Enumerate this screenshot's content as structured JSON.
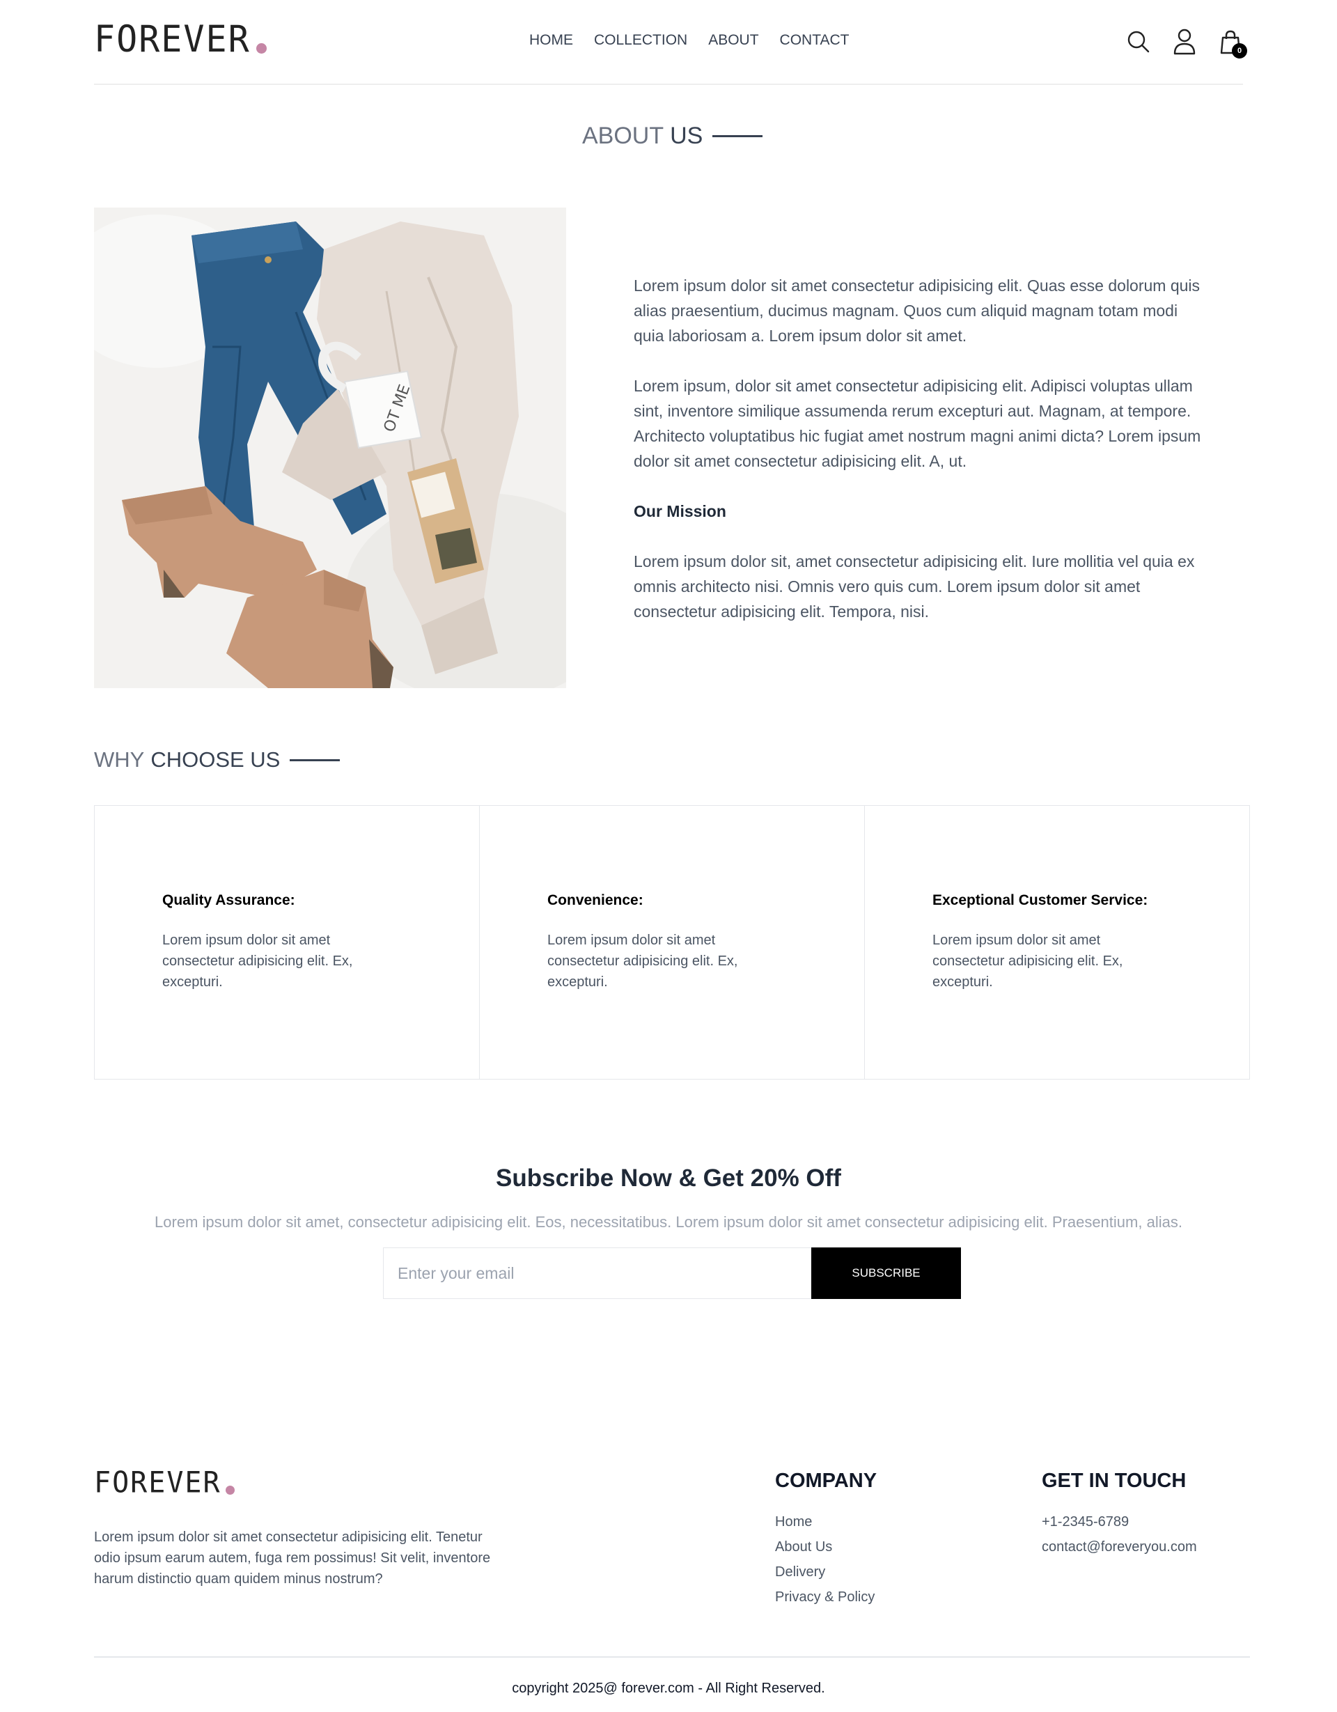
{
  "brand": {
    "name": "FOREVER",
    "accent_color": "#c586a5"
  },
  "nav": {
    "items": [
      {
        "label": "HOME"
      },
      {
        "label": "COLLECTION"
      },
      {
        "label": "ABOUT"
      },
      {
        "label": "CONTACT"
      }
    ]
  },
  "header_icons": {
    "search_icon": "search-icon",
    "profile_icon": "user-icon",
    "cart_icon": "shopping-bag-icon",
    "cart_count": "0"
  },
  "about": {
    "title_part1": "ABOUT",
    "title_part2": "US",
    "image": "flat-lay-clothes-jeans-sweater-boots-mug",
    "paragraph1": "Lorem ipsum dolor sit amet consectetur adipisicing elit. Quas esse dolorum quis alias praesentium, ducimus magnam. Quos cum aliquid magnam totam modi quia laboriosam a. Lorem ipsum dolor sit amet.",
    "paragraph2": "Lorem ipsum, dolor sit amet consectetur adipisicing elit. Adipisci voluptas ullam sint, inventore similique assumenda rerum excepturi aut. Magnam, at tempore. Architecto voluptatibus hic fugiat amet nostrum magni animi dicta? Lorem ipsum dolor sit amet consectetur adipisicing elit. A, ut.",
    "mission_heading": "Our Mission",
    "mission_text": "Lorem ipsum dolor sit, amet consectetur adipisicing elit. Iure mollitia vel quia ex omnis architecto nisi. Omnis vero quis cum. Lorem ipsum dolor sit amet consectetur adipisicing elit. Tempora, nisi."
  },
  "why": {
    "title_part1": "WHY",
    "title_part2": "CHOOSE US",
    "cards": [
      {
        "title": "Quality Assurance:",
        "text": "Lorem ipsum dolor sit amet consectetur adipisicing elit. Ex, excepturi."
      },
      {
        "title": "Convenience:",
        "text": "Lorem ipsum dolor sit amet consectetur adipisicing elit. Ex, excepturi."
      },
      {
        "title": "Exceptional Customer Service:",
        "text": "Lorem ipsum dolor sit amet consectetur adipisicing elit. Ex, excepturi."
      }
    ]
  },
  "subscribe": {
    "title": "Subscribe Now & Get 20% Off",
    "text": "Lorem ipsum dolor sit amet, consectetur adipisicing elit. Eos, necessitatibus. Lorem ipsum dolor sit amet consectetur adipisicing elit. Praesentium, alias.",
    "placeholder": "Enter your email",
    "button_label": "SUBSCRIBE"
  },
  "footer": {
    "description": "Lorem ipsum dolor sit amet consectetur adipisicing elit. Tenetur odio ipsum earum autem, fuga rem possimus! Sit velit, inventore harum distinctio quam quidem minus nostrum?",
    "company_heading": "COMPANY",
    "company_links": [
      {
        "label": "Home"
      },
      {
        "label": "About Us"
      },
      {
        "label": "Delivery"
      },
      {
        "label": "Privacy & Policy"
      }
    ],
    "contact_heading": "GET IN TOUCH",
    "phone": "+1-2345-6789",
    "email": "contact@foreveryou.com",
    "copyright": "copyright 2025@ forever.com - All Right Reserved."
  }
}
